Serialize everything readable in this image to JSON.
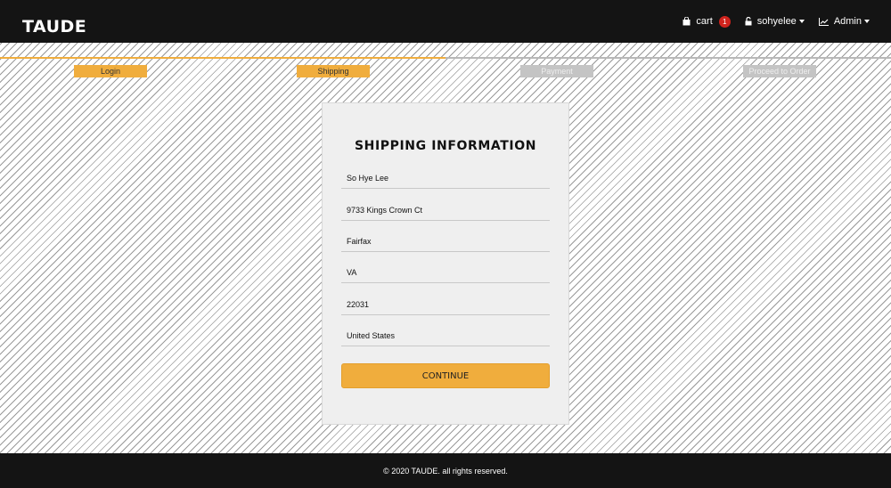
{
  "header": {
    "brand": "TAUDE",
    "cart_label": "cart",
    "cart_count": "1",
    "user_label": "sohyelee",
    "admin_label": "Admin"
  },
  "progress": {
    "fraction_complete": 0.5,
    "steps": [
      {
        "label": "Login",
        "state": "active"
      },
      {
        "label": "Shipping",
        "state": "active"
      },
      {
        "label": "Payment",
        "state": "inactive"
      },
      {
        "label": "Proceed to Order",
        "state": "inactive"
      }
    ]
  },
  "form": {
    "title": "SHIPPING INFORMATION",
    "fields": [
      {
        "name": "name",
        "value": "So Hye Lee"
      },
      {
        "name": "address",
        "value": "9733 Kings Crown Ct"
      },
      {
        "name": "city",
        "value": "Fairfax"
      },
      {
        "name": "state",
        "value": "VA"
      },
      {
        "name": "postal_code",
        "value": "22031"
      },
      {
        "name": "country",
        "value": "United States"
      }
    ],
    "continue_label": "CONTINUE"
  },
  "footer": {
    "text": "© 2020 TAUDE. all rights reserved."
  },
  "colors": {
    "accent": "#f0ad3d",
    "navbar": "#141414",
    "badge": "#d0231d",
    "inactive_step": "#c4c4c4"
  },
  "icons": {
    "cart": "shopping-bag-icon",
    "user": "lock-icon",
    "admin": "chart-line-icon"
  }
}
